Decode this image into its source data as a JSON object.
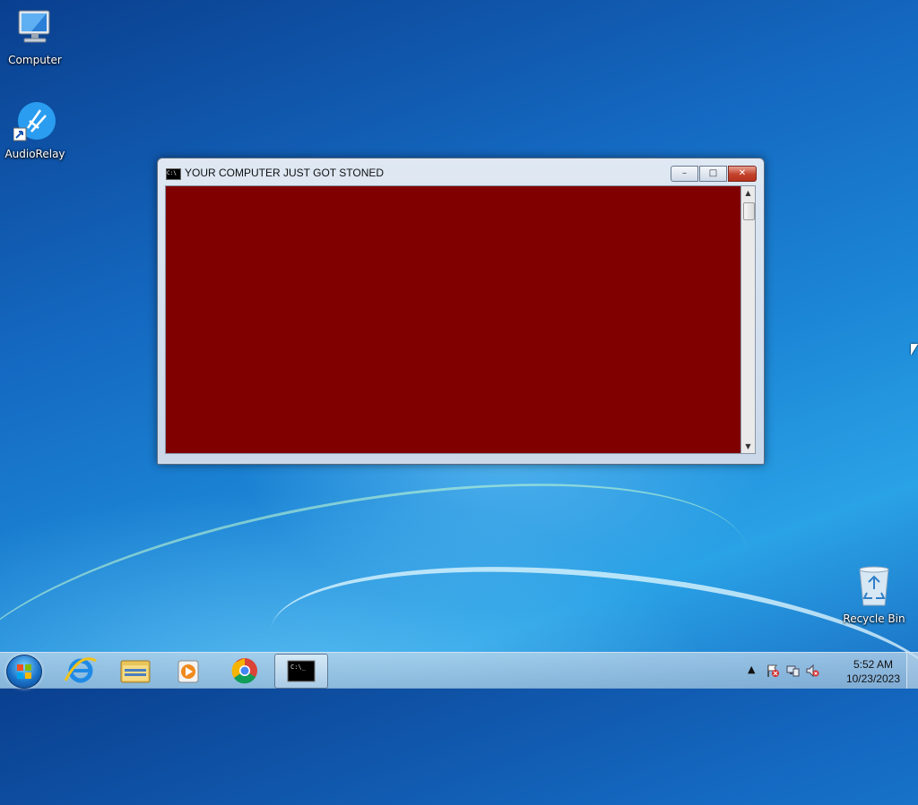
{
  "desktop": {
    "icons": [
      {
        "label": "Computer",
        "icon": "computer-icon"
      },
      {
        "label": "AudioRelay",
        "icon": "audiorelay-icon"
      },
      {
        "label": "Recycle Bin",
        "icon": "recycle-bin-icon"
      }
    ]
  },
  "console_window": {
    "title": "YOUR COMPUTER JUST GOT STONED",
    "minimize_symbol": "–",
    "maximize_symbol": "□",
    "close_symbol": "✕",
    "lines": [],
    "background_color": "#800000",
    "text_color": "#2a2aff"
  },
  "taskbar": {
    "start_button": "start-orb-icon",
    "pinned": [
      {
        "name": "internet-explorer-icon",
        "active": false
      },
      {
        "name": "file-explorer-icon",
        "active": false
      },
      {
        "name": "media-player-icon",
        "active": false
      },
      {
        "name": "chrome-icon",
        "active": false
      },
      {
        "name": "command-prompt-icon",
        "active": true
      }
    ],
    "tray": {
      "show_hidden_symbol": "▲",
      "icons": [
        "action-center-flag-icon",
        "network-icon",
        "volume-muted-icon"
      ]
    },
    "clock": {
      "time": "5:52 AM",
      "date": "10/23/2023"
    }
  }
}
